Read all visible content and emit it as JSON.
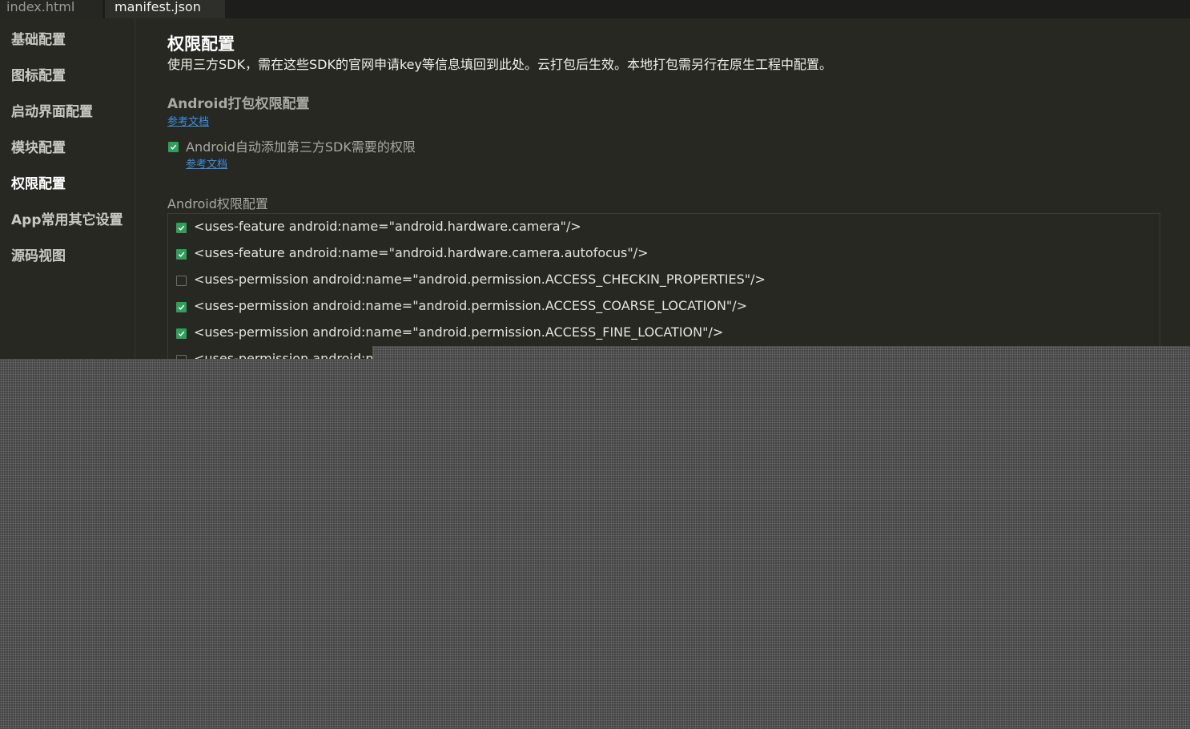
{
  "tabs": [
    {
      "label": "index.html",
      "active": false
    },
    {
      "label": "manifest.json",
      "active": true
    }
  ],
  "sidebar": {
    "items": [
      {
        "label": "基础配置",
        "active": false
      },
      {
        "label": "图标配置",
        "active": false
      },
      {
        "label": "启动界面配置",
        "active": false
      },
      {
        "label": "模块配置",
        "active": false
      },
      {
        "label": "权限配置",
        "active": true
      },
      {
        "label": "App常用其它设置",
        "active": false
      },
      {
        "label": "源码视图",
        "active": false
      }
    ]
  },
  "main": {
    "title": "权限配置",
    "description": "使用三方SDK，需在这些SDK的官网申请key等信息填回到此处。云打包后生效。本地打包需另行在原生工程中配置。",
    "android_section": {
      "title": "Android打包权限配置",
      "doc_link": "参考文档",
      "auto_add": {
        "label": "Android自动添加第三方SDK需要的权限",
        "checked": true,
        "doc_link": "参考文档"
      },
      "permissions_label": "Android权限配置",
      "permissions": [
        {
          "text": "<uses-feature android:name=\"android.hardware.camera\"/>",
          "checked": true
        },
        {
          "text": "<uses-feature android:name=\"android.hardware.camera.autofocus\"/>",
          "checked": true
        },
        {
          "text": "<uses-permission android:name=\"android.permission.ACCESS_CHECKIN_PROPERTIES\"/>",
          "checked": false
        },
        {
          "text": "<uses-permission android:name=\"android.permission.ACCESS_COARSE_LOCATION\"/>",
          "checked": true
        },
        {
          "text": "<uses-permission android:name=\"android.permission.ACCESS_FINE_LOCATION\"/>",
          "checked": true
        },
        {
          "text": "<uses-permission android:name=",
          "checked": false
        }
      ]
    }
  },
  "colors": {
    "background": "#272822",
    "link": "#3b8fe4",
    "checkbox_checked": "#2fa05a"
  }
}
